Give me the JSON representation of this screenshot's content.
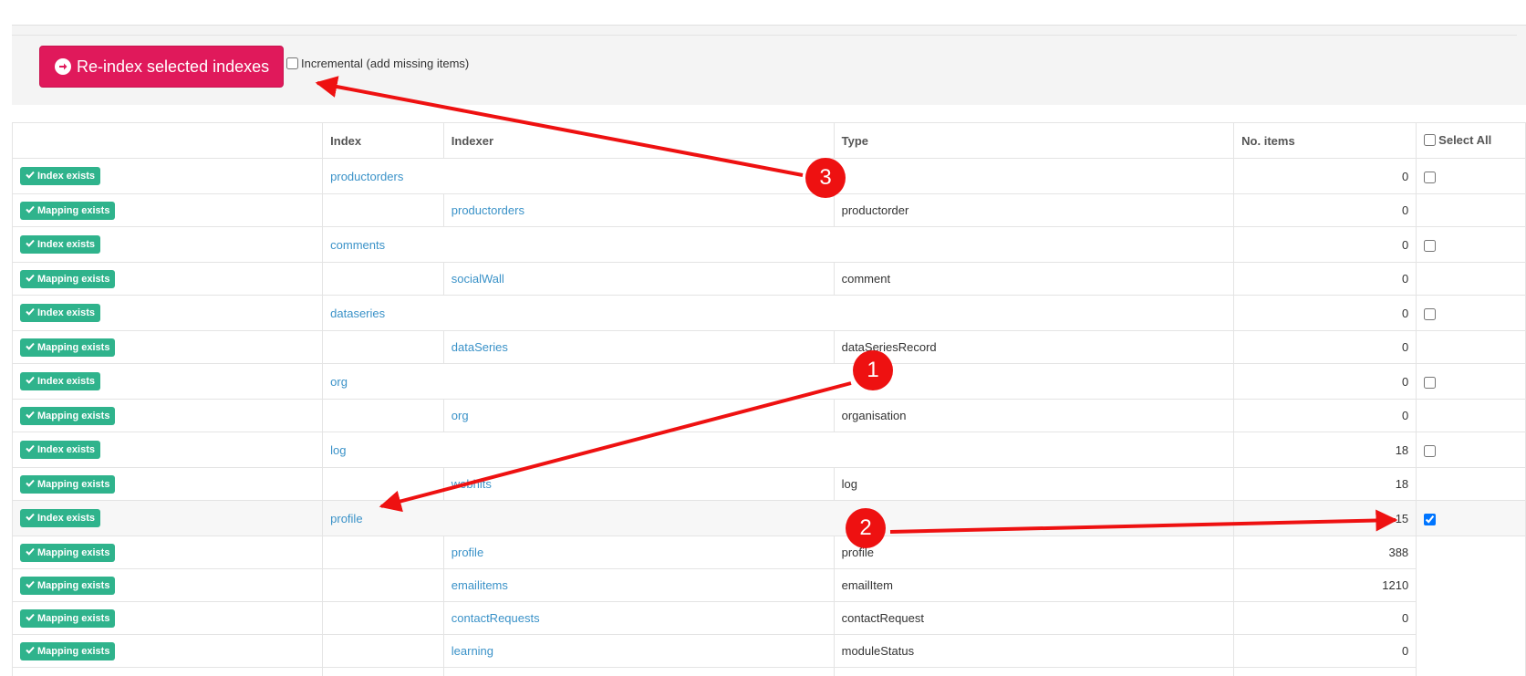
{
  "toolbar": {
    "reindex_label": "Re-index selected indexes",
    "incremental_label": "Incremental (add missing items)",
    "incremental_checked": false
  },
  "table": {
    "headers": {
      "status": "",
      "index": "Index",
      "indexer": "Indexer",
      "type": "Type",
      "items": "No. items",
      "select_all": "Select All"
    },
    "rows": [
      {
        "kind": "index",
        "badge": "Index exists",
        "index": "productorders",
        "items": "0",
        "checked": false
      },
      {
        "kind": "mapping",
        "badge": "Mapping exists",
        "indexer": "productorders",
        "type": "productorder",
        "items": "0"
      },
      {
        "kind": "index",
        "badge": "Index exists",
        "index": "comments",
        "items": "0",
        "checked": false
      },
      {
        "kind": "mapping",
        "badge": "Mapping exists",
        "indexer": "socialWall",
        "type": "comment",
        "items": "0"
      },
      {
        "kind": "index",
        "badge": "Index exists",
        "index": "dataseries",
        "items": "0",
        "checked": false
      },
      {
        "kind": "mapping",
        "badge": "Mapping exists",
        "indexer": "dataSeries",
        "type": "dataSeriesRecord",
        "items": "0"
      },
      {
        "kind": "index",
        "badge": "Index exists",
        "index": "org",
        "items": "0",
        "checked": false
      },
      {
        "kind": "mapping",
        "badge": "Mapping exists",
        "indexer": "org",
        "type": "organisation",
        "items": "0"
      },
      {
        "kind": "index",
        "badge": "Index exists",
        "index": "log",
        "items": "18",
        "checked": false
      },
      {
        "kind": "mapping",
        "badge": "Mapping exists",
        "indexer": "webhits",
        "type": "log",
        "items": "18"
      },
      {
        "kind": "index",
        "badge": "Index exists",
        "index": "profile",
        "items": "15",
        "checked": true,
        "highlight": true
      },
      {
        "kind": "mapping",
        "badge": "Mapping exists",
        "indexer": "profile",
        "type": "profile",
        "items": "388"
      },
      {
        "kind": "mapping",
        "badge": "Mapping exists",
        "indexer": "emailitems",
        "type": "emailItem",
        "items": "1210"
      },
      {
        "kind": "mapping",
        "badge": "Mapping exists",
        "indexer": "contactRequests",
        "type": "contactRequest",
        "items": "0"
      },
      {
        "kind": "mapping",
        "badge": "Mapping exists",
        "indexer": "learning",
        "type": "moduleStatus",
        "items": "0"
      },
      {
        "kind": "mapping",
        "badge": "",
        "indexer": "",
        "type": "",
        "items": ""
      }
    ]
  },
  "annotations": {
    "marker_1": "1",
    "marker_2": "2",
    "marker_3": "3",
    "color": "#ee1111"
  },
  "colors": {
    "primary_button": "#e0195b",
    "badge": "#2fb38c",
    "link": "#3a92c8"
  }
}
